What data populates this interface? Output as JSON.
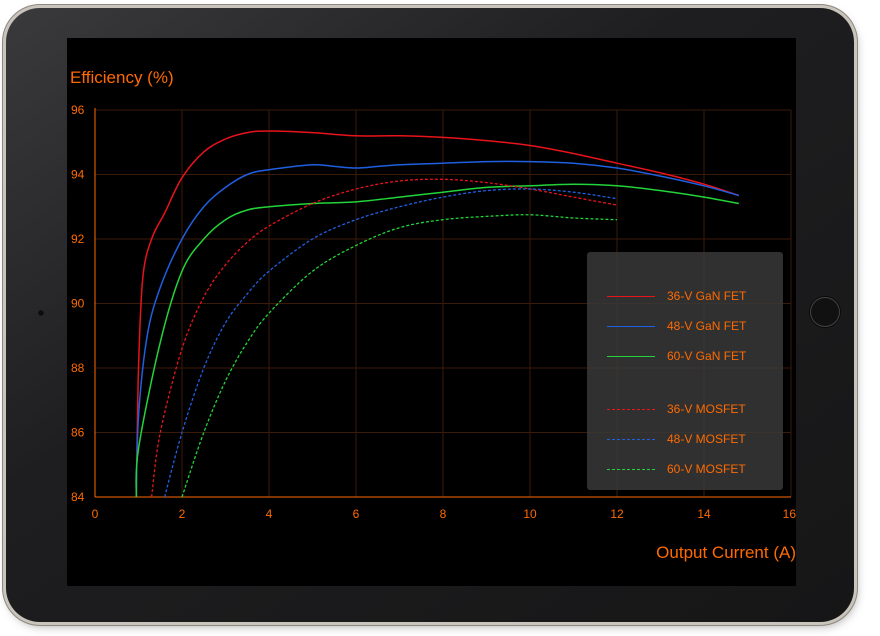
{
  "colors": {
    "accent": "#ff6a00",
    "grid": "#3a1a08",
    "red": "#e8131b",
    "blue": "#1f5fe0",
    "green": "#22d43a"
  },
  "chart_data": {
    "type": "line",
    "xlabel": "Output Current (A)",
    "ylabel": "Efficiency (%)",
    "xlim": [
      0,
      16
    ],
    "ylim": [
      84,
      96
    ],
    "xticks": [
      0,
      2,
      4,
      6,
      8,
      10,
      12,
      14,
      16
    ],
    "yticks": [
      84,
      86,
      88,
      90,
      92,
      94,
      96
    ],
    "grid": true,
    "legend_position": "right",
    "series": [
      {
        "name": "36-V GaN FET",
        "color": "#e8131b",
        "style": "solid",
        "x": [
          0.95,
          1.0,
          1.1,
          1.3,
          1.6,
          2.0,
          2.5,
          3.0,
          3.5,
          4.0,
          5.0,
          6.0,
          7.0,
          8.0,
          9.0,
          10.0,
          11.0,
          12.0,
          13.0,
          14.0,
          14.8
        ],
        "y": [
          84.0,
          88.0,
          90.8,
          92.0,
          92.8,
          93.9,
          94.7,
          95.1,
          95.3,
          95.35,
          95.3,
          95.2,
          95.2,
          95.15,
          95.05,
          94.9,
          94.65,
          94.35,
          94.05,
          93.7,
          93.35
        ]
      },
      {
        "name": "48-V GaN FET",
        "color": "#1f5fe0",
        "style": "solid",
        "x": [
          0.95,
          1.0,
          1.2,
          1.5,
          2.0,
          2.5,
          3.0,
          3.5,
          4.0,
          5.0,
          5.5,
          6.0,
          6.5,
          7.0,
          8.0,
          9.0,
          10.0,
          11.0,
          12.0,
          13.0,
          14.0,
          14.8
        ],
        "y": [
          84.0,
          86.5,
          89.0,
          90.5,
          92.0,
          93.0,
          93.6,
          94.0,
          94.15,
          94.3,
          94.25,
          94.2,
          94.25,
          94.3,
          94.35,
          94.4,
          94.4,
          94.35,
          94.2,
          93.95,
          93.65,
          93.35
        ]
      },
      {
        "name": "60-V GaN FET",
        "color": "#22d43a",
        "style": "solid",
        "x": [
          0.95,
          1.0,
          1.5,
          2.0,
          2.5,
          3.0,
          3.5,
          4.0,
          5.0,
          6.0,
          7.0,
          8.0,
          9.0,
          10.0,
          11.0,
          12.0,
          13.0,
          14.0,
          14.8
        ],
        "y": [
          84.0,
          85.5,
          88.8,
          91.0,
          92.0,
          92.6,
          92.9,
          93.0,
          93.1,
          93.15,
          93.3,
          93.45,
          93.6,
          93.65,
          93.7,
          93.65,
          93.5,
          93.3,
          93.1
        ]
      },
      {
        "name": "36-V MOSFET",
        "color": "#e8131b",
        "style": "dashed",
        "x": [
          1.3,
          1.5,
          2.0,
          2.5,
          3.0,
          3.5,
          4.0,
          5.0,
          6.0,
          7.0,
          8.0,
          9.0,
          10.0,
          11.0,
          12.0
        ],
        "y": [
          84.0,
          86.0,
          88.6,
          90.2,
          91.2,
          91.9,
          92.4,
          93.1,
          93.55,
          93.8,
          93.85,
          93.75,
          93.55,
          93.3,
          93.05
        ]
      },
      {
        "name": "48-V MOSFET",
        "color": "#1f5fe0",
        "style": "dashed",
        "x": [
          1.6,
          2.0,
          2.5,
          3.0,
          3.5,
          4.0,
          5.0,
          6.0,
          7.0,
          8.0,
          9.0,
          10.0,
          11.0,
          12.0
        ],
        "y": [
          84.0,
          86.0,
          88.0,
          89.4,
          90.3,
          91.0,
          92.0,
          92.6,
          93.0,
          93.3,
          93.5,
          93.55,
          93.45,
          93.25
        ]
      },
      {
        "name": "60-V MOSFET",
        "color": "#22d43a",
        "style": "dashed",
        "x": [
          2.0,
          2.5,
          3.0,
          3.5,
          4.0,
          5.0,
          6.0,
          7.0,
          8.0,
          9.0,
          10.0,
          11.0,
          12.0
        ],
        "y": [
          84.0,
          86.0,
          87.6,
          88.8,
          89.7,
          91.0,
          91.8,
          92.35,
          92.6,
          92.7,
          92.75,
          92.65,
          92.6
        ]
      }
    ]
  },
  "legend": [
    {
      "label": "36-V GaN FET",
      "color": "#e8131b",
      "style": "solid"
    },
    {
      "label": "48-V GaN FET",
      "color": "#1f5fe0",
      "style": "solid"
    },
    {
      "label": "60-V GaN FET",
      "color": "#22d43a",
      "style": "solid"
    },
    {
      "label": "36-V MOSFET",
      "color": "#e8131b",
      "style": "dashed"
    },
    {
      "label": "48-V MOSFET",
      "color": "#1f5fe0",
      "style": "dashed"
    },
    {
      "label": "60-V MOSFET",
      "color": "#22d43a",
      "style": "dashed"
    }
  ]
}
